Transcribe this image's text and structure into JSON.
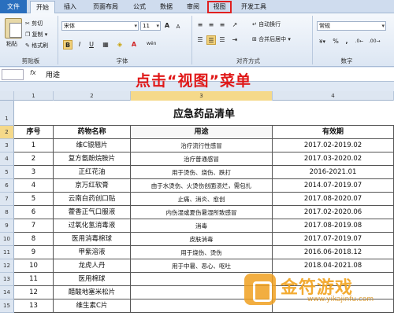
{
  "ribbon_tabs": [
    {
      "label": "文件",
      "state": "file"
    },
    {
      "label": "开始",
      "state": "active"
    },
    {
      "label": "插入",
      "state": ""
    },
    {
      "label": "页面布局",
      "state": ""
    },
    {
      "label": "公式",
      "state": ""
    },
    {
      "label": "数据",
      "state": ""
    },
    {
      "label": "审阅",
      "state": ""
    },
    {
      "label": "视图",
      "state": "highlighted"
    },
    {
      "label": "开发工具",
      "state": ""
    }
  ],
  "clipboard": {
    "paste": "粘贴",
    "cut": "剪切",
    "copy": "复制",
    "format_painter": "格式刷",
    "group": "剪贴板"
  },
  "font": {
    "name": "宋体",
    "size": "11",
    "bold": "B",
    "italic": "I",
    "underline": "U",
    "grow": "A",
    "shrink": "A",
    "group": "字体",
    "wen": "wén"
  },
  "alignment": {
    "wrap": "自动换行",
    "merge": "合并后居中",
    "group": "对齐方式"
  },
  "number": {
    "format": "常规",
    "percent": "%",
    "comma": ",",
    "group": "数字"
  },
  "formula_bar": {
    "fx": "fx",
    "value": "用途"
  },
  "annotation": "点击“视图”菜单",
  "columns": [
    "1",
    "2",
    "3",
    "4"
  ],
  "sheet": {
    "title": "应急药品清单",
    "headers": [
      "序号",
      "药物名称",
      "用途",
      "有效期"
    ],
    "rows": [
      [
        "1",
        "维C银翘片",
        "治疗流行性感冒",
        "2017.02-2019.02"
      ],
      [
        "2",
        "复方氨酚烷胺片",
        "治疗普通感冒",
        "2017.03-2020.02"
      ],
      [
        "3",
        "正红花油",
        "用于烫伤、烧伤、跌打",
        "2016-2021.01"
      ],
      [
        "4",
        "京万红软膏",
        "由于水烫伤、火烫伤创面溃烂，需包扎",
        "2014.07-2019.07"
      ],
      [
        "5",
        "云南白药创口贴",
        "止痛、消炎、愈创",
        "2017.08-2020.07"
      ],
      [
        "6",
        "藿香正气口服液",
        "内伤湿或夏伤暑湿所致感冒",
        "2017.02-2020.06"
      ],
      [
        "7",
        "过氧化氢消毒液",
        "消毒",
        "2017.08-2019.08"
      ],
      [
        "8",
        "医用消毒棉球",
        "皮肤消毒",
        "2017.07-2019.07"
      ],
      [
        "9",
        "甲紫溶液",
        "用于烧伤、烫伤",
        "2016.06-2018.12"
      ],
      [
        "10",
        "龙虎人丹",
        "用于中暑、恶心、呕吐",
        "2018.04-2021.08"
      ],
      [
        "11",
        "医用棉球",
        "",
        ""
      ],
      [
        "12",
        "醋酸地塞米松片",
        "",
        ""
      ],
      [
        "13",
        "维生素C片",
        "",
        ""
      ]
    ],
    "row_numbers": [
      "1",
      "2",
      "3",
      "4",
      "5",
      "6",
      "7",
      "8",
      "9",
      "10",
      "11",
      "12",
      "13",
      "14",
      "15"
    ]
  },
  "watermark": {
    "text": "金符游戏",
    "sub": "www.yikajinfu.com"
  },
  "colors": {
    "accent_red": "#e02020",
    "file_tab": "#2a6fbe",
    "selection": "#f5d98a"
  }
}
